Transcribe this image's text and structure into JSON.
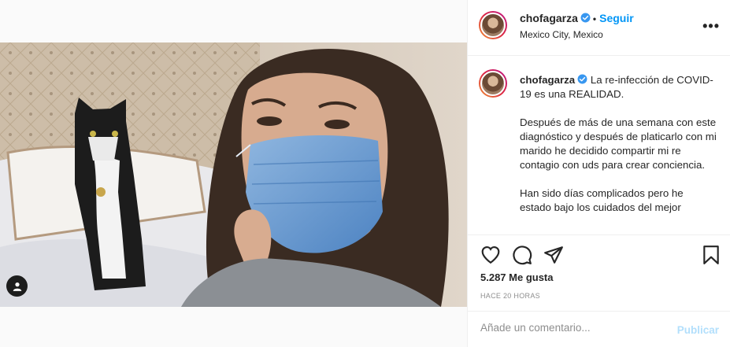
{
  "post": {
    "username": "chofagarza",
    "follow_label": "Seguir",
    "location": "Mexico City, Mexico",
    "caption": [
      "La re-infección de COVID-19 es una REALIDAD.",
      "Después de más de una semana con este diagnóstico y después de platicarlo con mi marido he decidido compartir mi re contagio con uds para crear conciencia.",
      "Han sido días complicados pero he estado bajo los cuidados del mejor"
    ],
    "likes": "5.287 Me gusta",
    "timestamp": "HACE 20 HORAS",
    "comment_placeholder": "Añade un comentario...",
    "publish_label": "Publicar"
  },
  "icons": {
    "verified": "verified-badge-icon",
    "more": "more-options-icon",
    "like": "heart-icon",
    "comment": "comment-bubble-icon",
    "share": "paper-plane-icon",
    "save": "bookmark-icon",
    "tag": "user-tag-icon"
  },
  "colors": {
    "accent": "#0095f6",
    "publish_disabled": "#b2dffc",
    "text": "#262626",
    "muted": "#8e8e8e"
  }
}
